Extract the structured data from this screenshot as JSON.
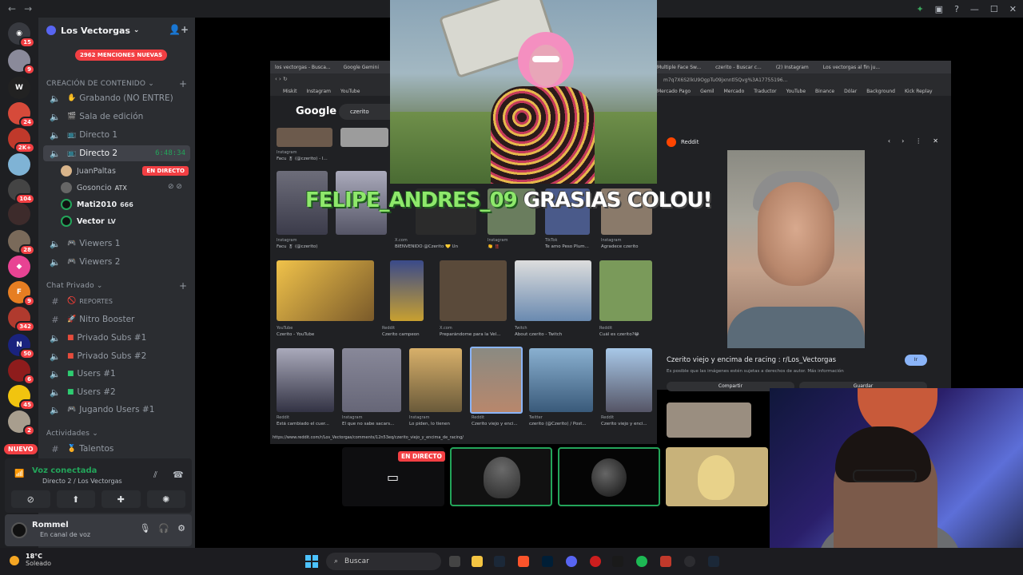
{
  "server": {
    "name": "Los Vectorgas",
    "mentions_label": "2962 MENCIONES NUEVAS",
    "new_label": "NUEVO"
  },
  "rail_badges": [
    "15",
    "9",
    "24",
    "2K+",
    "104",
    "28",
    "9",
    "342",
    "50",
    "6",
    "45",
    "2"
  ],
  "categories": {
    "content": "CREACIÓN DE CONTENIDO",
    "private": "Chat Privado",
    "activities": "Actividades"
  },
  "channels": {
    "grabando": "Grabando (NO ENTRE)",
    "sala_edicion": "Sala de edición",
    "directo1": "Directo 1",
    "directo2": "Directo 2",
    "directo2_timer": "6:48:34",
    "viewers1": "Viewers 1",
    "viewers2": "Viewers 2",
    "reportes": "REPORTES",
    "nitro": "Nitro Booster",
    "privado_subs1": "Privado Subs #1",
    "privado_subs2": "Privado Subs #2",
    "users1": "Users #1",
    "users2": "Users #2",
    "jugando": "Jugando Users #1",
    "talentos": "Talentos"
  },
  "voice_users": [
    {
      "name": "JuanPaltas",
      "tag": "",
      "live": "EN DIRECTO"
    },
    {
      "name": "Gosoncio",
      "tag": "ATX",
      "live": ""
    },
    {
      "name": "Mati2010",
      "tag": "666",
      "live": ""
    },
    {
      "name": "Vector",
      "tag": "LV",
      "live": ""
    }
  ],
  "voice_panel": {
    "title": "Voz conectada",
    "subtitle": "Directo 2 / Los Vectorgas"
  },
  "user_panel": {
    "name": "Rommel",
    "status": "En canal de voz"
  },
  "stream": {
    "live_badge": "EN DIRECTO",
    "alert_name": "FELIPE_ANDRES_09",
    "alert_msg": "GRASIAS COLOU!",
    "browser_left": {
      "tabs": [
        "los vectorgas - Busca...",
        "Google Gemini"
      ],
      "bookmarks": [
        "Miskit",
        "Instagram",
        "YouTube"
      ],
      "google_logo": "Google",
      "search_query": "czerito",
      "results": [
        {
          "src": "Instagram",
          "label": "Facu 🎖 (@czerito) - I..."
        },
        {
          "src": "Instagram",
          "label": "Facu 🎖 (@czerito)"
        },
        {
          "src": "X.com",
          "label": "BIENVENIDO @Czerito 💛 Un"
        },
        {
          "src": "Instagram",
          "label": "👏 ‼️"
        },
        {
          "src": "TikTok",
          "label": "Te amo Peso Plum..."
        },
        {
          "src": "Instagram",
          "label": "Agradece czerito"
        },
        {
          "src": "YouTube",
          "label": "Czerito - YouTube"
        },
        {
          "src": "Reddit",
          "label": "Czerito campeon"
        },
        {
          "src": "X.com",
          "label": "Preparándome para la Vel..."
        },
        {
          "src": "Twitch",
          "label": "About czerito - Twitch"
        },
        {
          "src": "Reddit",
          "label": "Cuál es czerito?😂"
        },
        {
          "src": "Reddit",
          "label": "Está cambiado el cuer..."
        },
        {
          "src": "Instagram",
          "label": "El que no sabe sacars..."
        },
        {
          "src": "Instagram",
          "label": "Lo piden, lo tienen"
        },
        {
          "src": "Reddit",
          "label": "Czerito viejo y enci..."
        },
        {
          "src": "Twitter",
          "label": "czerito (@Czerito) / Post..."
        },
        {
          "src": "Reddit",
          "label": "Czerito viejo y enci..."
        }
      ],
      "status_url": "https://www.reddit.com/r/Los_Vectorgas/comments/12n53eq/czerito_viejo_y_encima_de_racing/"
    },
    "browser_right": {
      "tabs": [
        "Multiple Face Sw...",
        "czerito - Buscar c...",
        "(2) Instagram",
        "Los vectorgas al fin ju..."
      ],
      "address": "m7q7X6S2lkU9OgpTu09jxnntl5Qvg%3A17755196...",
      "bookmarks": [
        "Mercado Pago",
        "Gemil",
        "Mercado",
        "Traductor",
        "YouTube",
        "Binance",
        "Dólar",
        "Background",
        "Kick Replay"
      ],
      "source": "Reddit",
      "title": "Czerito viejo y encima de racing : r/Los_Vectorgas",
      "subtitle": "Es posible que las imágenes estén sujetas a derechos de autor. Más información",
      "visit_label": "Ir",
      "share_label": "Compartir",
      "save_label": "Guardar"
    }
  },
  "taskbar": {
    "temp": "18°C",
    "weather": "Soleado",
    "search": "Buscar"
  }
}
